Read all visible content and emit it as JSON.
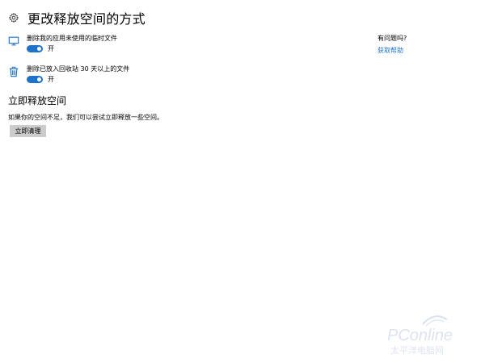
{
  "header": {
    "title": "更改释放空间的方式",
    "icon": "gear-icon"
  },
  "settings": [
    {
      "icon": "monitor-icon",
      "label": "删除我的应用未使用的临时文件",
      "toggle_state": "开",
      "on": true
    },
    {
      "icon": "trash-icon",
      "label": "删除已放入回收站 30 天以上的文件",
      "toggle_state": "开",
      "on": true
    }
  ],
  "free_space": {
    "title": "立即释放空间",
    "description": "如果你的空间不足，我们可以尝试立即释放一些空间。",
    "button_label": "立即清理"
  },
  "help": {
    "title": "有问题吗?",
    "link_label": "获取帮助"
  },
  "watermark": {
    "brand": "PConline",
    "subtitle": "太平洋电脑网"
  },
  "colors": {
    "accent": "#1e73c8",
    "button_bg": "#cccccc",
    "background": "#ffffff"
  }
}
